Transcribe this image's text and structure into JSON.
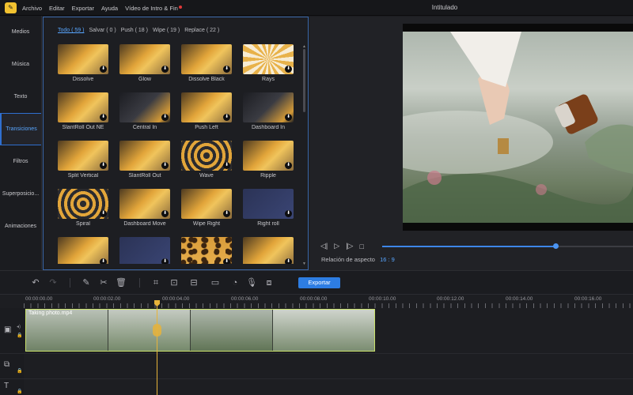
{
  "menu": {
    "items": [
      "Archivo",
      "Editar",
      "Exportar",
      "Ayuda",
      "Vídeo de Intro & Fin"
    ],
    "logo_icon": "app-logo-icon",
    "notification_color": "#e03838"
  },
  "app": {
    "title": "Intitulado"
  },
  "sidebar": {
    "items": [
      {
        "label": "Medios",
        "active": false
      },
      {
        "label": "Música",
        "active": false
      },
      {
        "label": "Texto",
        "active": false
      },
      {
        "label": "Transiciones",
        "active": true
      },
      {
        "label": "Filtros",
        "active": false
      },
      {
        "label": "Superposicio...",
        "active": false
      },
      {
        "label": "Animaciones",
        "active": false
      }
    ]
  },
  "transitions": {
    "filters": [
      {
        "label": "Todo ( 59 )",
        "active": true
      },
      {
        "label": "Salvar ( 0 )",
        "active": false
      },
      {
        "label": "Push ( 18 )",
        "active": false
      },
      {
        "label": "Wipe ( 19 )",
        "active": false
      },
      {
        "label": "Replace ( 22 )",
        "active": false
      }
    ],
    "items": [
      {
        "label": "Dissolve",
        "theme": "warm"
      },
      {
        "label": "Glow",
        "theme": "warm"
      },
      {
        "label": "Dissolve Black",
        "theme": "warm"
      },
      {
        "label": "Rays",
        "theme": "rays"
      },
      {
        "label": "SlantRoll Out NE",
        "theme": "warm"
      },
      {
        "label": "Central In",
        "theme": "dark"
      },
      {
        "label": "Push Left",
        "theme": "warm"
      },
      {
        "label": "Dashboard In",
        "theme": "dark"
      },
      {
        "label": "Split Vertical",
        "theme": "warm"
      },
      {
        "label": "SlantRoll Out",
        "theme": "warm"
      },
      {
        "label": "Wave",
        "theme": "spiral"
      },
      {
        "label": "Ripple",
        "theme": "warm"
      },
      {
        "label": "Spiral",
        "theme": "spiral"
      },
      {
        "label": "Dashboard Move",
        "theme": "warm"
      },
      {
        "label": "Wipe Right",
        "theme": "warm"
      },
      {
        "label": "Right roll",
        "theme": "navy"
      },
      {
        "label": "",
        "theme": "warm"
      },
      {
        "label": "",
        "theme": "navy"
      },
      {
        "label": "",
        "theme": "leopard"
      },
      {
        "label": "",
        "theme": "warm"
      }
    ],
    "download_icon": "download-icon"
  },
  "preview": {
    "aspect_label": "Relación de aspecto",
    "aspect_value": "16 : 9",
    "progress": 0.69
  },
  "toolbar": {
    "export_label": "Exportar",
    "icons": [
      "undo-icon",
      "redo-icon",
      "pen-icon",
      "scissors-icon",
      "trash-icon",
      "crop-icon",
      "resize-icon",
      "split-icon",
      "freeze-frame-icon",
      "speed-icon",
      "microphone-icon",
      "screenshot-icon"
    ]
  },
  "timeline": {
    "ruler": [
      "00:00:00.00",
      "00:00:02.00",
      "00:00:04.00",
      "00:00:06.00",
      "00:00:08.00",
      "00:00:10.00",
      "00:00:12.00",
      "00:00:14.00",
      "00:00:16.00"
    ],
    "clip_name": "Taking photo.mp4",
    "accent": "#c8e06a",
    "playhead_color": "#e7b33a"
  }
}
